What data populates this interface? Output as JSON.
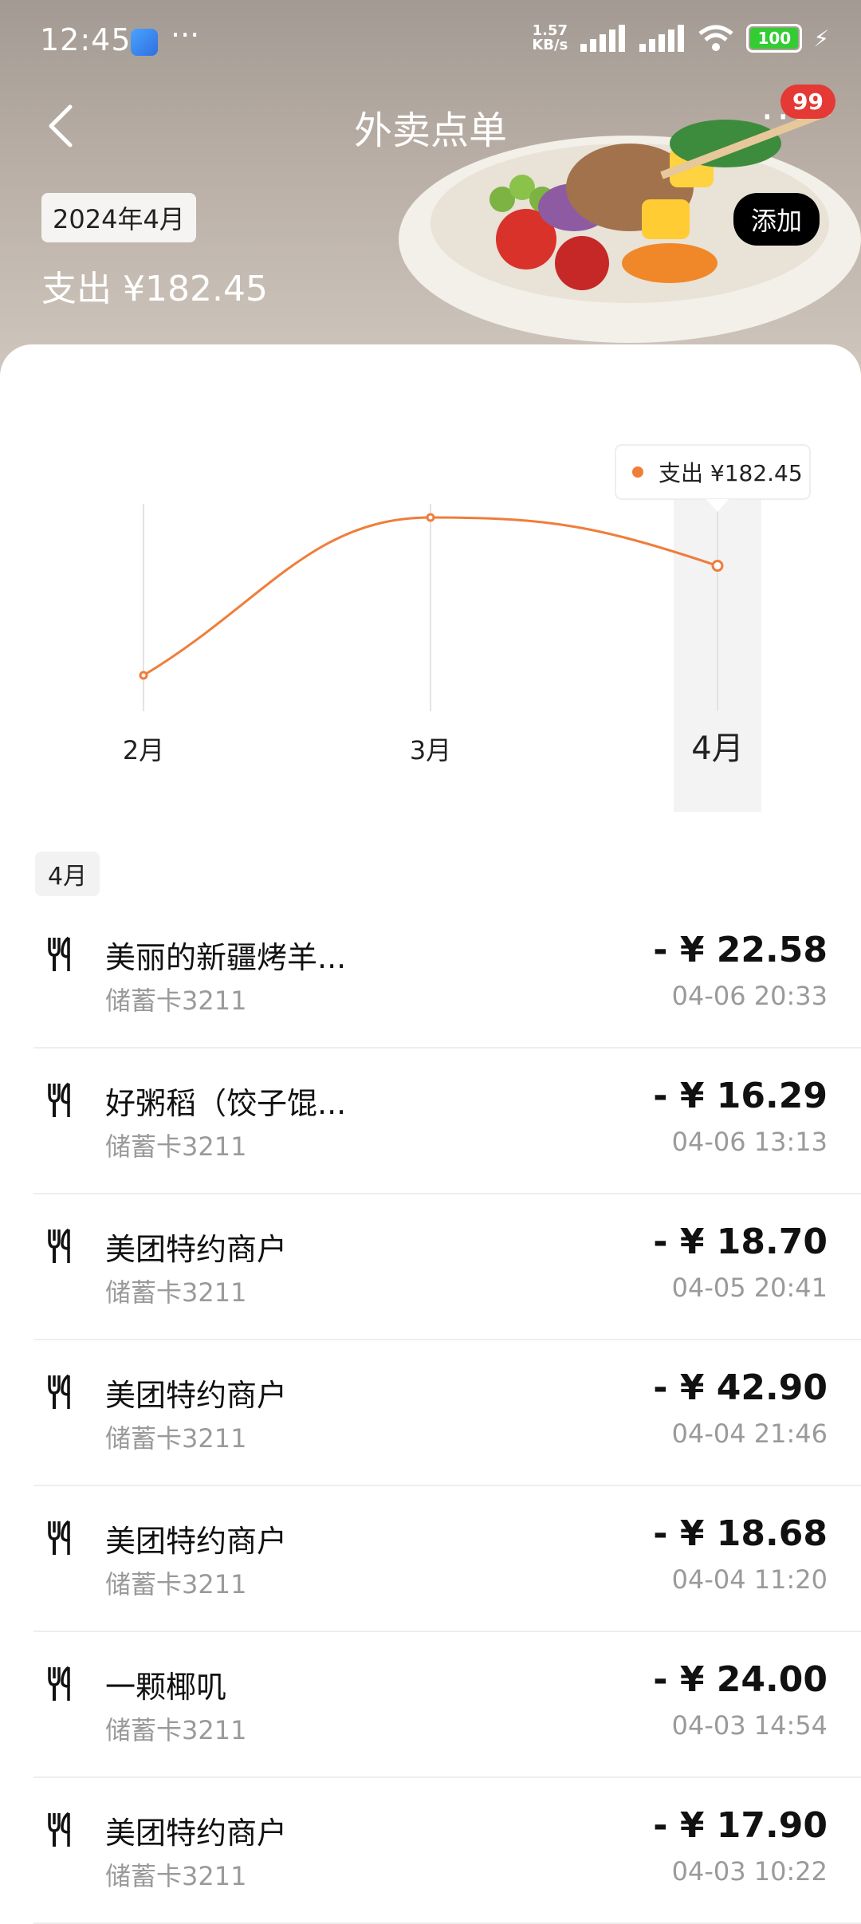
{
  "status_bar": {
    "time": "12:45",
    "more": "···",
    "net_speed_top": "1.57",
    "net_speed_unit": "KB/s",
    "battery": "100"
  },
  "nav": {
    "title": "外卖点单",
    "menu": "···",
    "badge": "99"
  },
  "summary": {
    "month": "2024年4月",
    "total": "支出 ¥182.45",
    "add_label": "添加"
  },
  "chart_data": {
    "type": "line",
    "categories": [
      "2月",
      "3月",
      "4月"
    ],
    "series": [
      {
        "name": "支出",
        "values": [
          45,
          243,
          182.45
        ]
      }
    ],
    "ylim": [
      0,
      260
    ],
    "tooltip": "支出 ¥182.45",
    "selected_index": 2,
    "colors": {
      "line": "#f07d3a"
    }
  },
  "list": {
    "section_label": "4月",
    "items": [
      {
        "name": "美丽的新疆烤羊...",
        "card": "储蓄卡3211",
        "amount": "- ¥ 22.58",
        "date": "04-06 20:33"
      },
      {
        "name": "好粥稻（饺子馄...",
        "card": "储蓄卡3211",
        "amount": "- ¥ 16.29",
        "date": "04-06 13:13"
      },
      {
        "name": "美团特约商户",
        "card": "储蓄卡3211",
        "amount": "- ¥ 18.70",
        "date": "04-05 20:41"
      },
      {
        "name": "美团特约商户",
        "card": "储蓄卡3211",
        "amount": "- ¥ 42.90",
        "date": "04-04 21:46"
      },
      {
        "name": "美团特约商户",
        "card": "储蓄卡3211",
        "amount": "- ¥ 18.68",
        "date": "04-04 11:20"
      },
      {
        "name": "一颗椰叽",
        "card": "储蓄卡3211",
        "amount": "- ¥ 24.00",
        "date": "04-03 14:54"
      },
      {
        "name": "美团特约商户",
        "card": "储蓄卡3211",
        "amount": "- ¥ 17.90",
        "date": "04-03 10:22"
      }
    ]
  }
}
